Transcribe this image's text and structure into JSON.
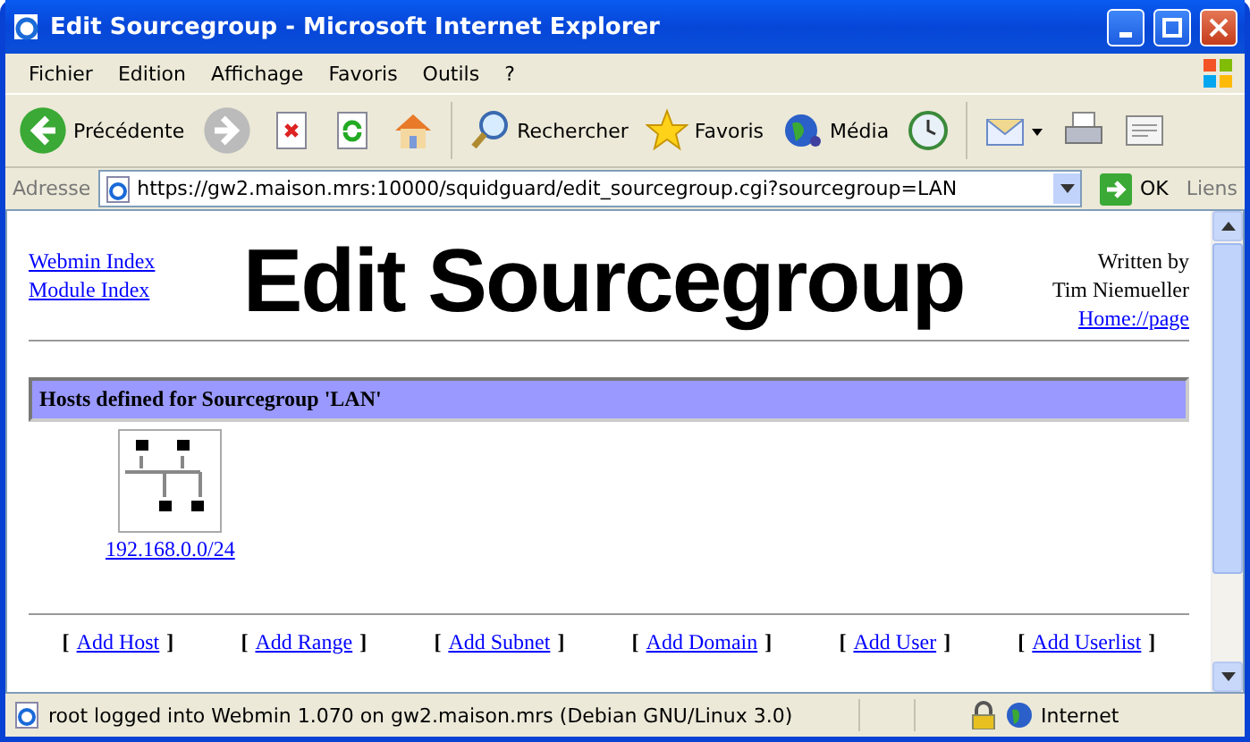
{
  "window": {
    "title": "Edit Sourcegroup - Microsoft Internet Explorer"
  },
  "menu": [
    "Fichier",
    "Edition",
    "Affichage",
    "Favoris",
    "Outils",
    "?"
  ],
  "toolbar": [
    {
      "kind": "back",
      "label": "Précédente"
    },
    {
      "kind": "forward"
    },
    {
      "kind": "stop"
    },
    {
      "kind": "refresh"
    },
    {
      "kind": "home"
    },
    {
      "kind": "search",
      "label": "Rechercher"
    },
    {
      "kind": "favorites",
      "label": "Favoris"
    },
    {
      "kind": "media",
      "label": "Média"
    },
    {
      "kind": "history"
    },
    {
      "kind": "mail"
    },
    {
      "kind": "print"
    },
    {
      "kind": "edit"
    }
  ],
  "address": {
    "label": "Adresse",
    "url": "https://gw2.maison.mrs:10000/squidguard/edit_sourcegroup.cgi?sourcegroup=LAN",
    "go": "OK",
    "links": "Liens"
  },
  "page": {
    "nav_links": [
      "Webmin Index",
      "Module Index"
    ],
    "heading": "Edit Sourcegroup",
    "author_lines": [
      "Written by",
      "Tim Niemueller"
    ],
    "author_link": "Home://page",
    "section_title": "Hosts defined for Sourcegroup 'LAN'",
    "hosts": [
      {
        "label": "192.168.0.0/24"
      }
    ],
    "open_bracket": "[",
    "close_bracket": "]",
    "add_links": [
      "Add Host",
      "Add Range",
      "Add Subnet",
      "Add Domain",
      "Add User",
      "Add Userlist"
    ]
  },
  "status_bar": {
    "text": "root logged into Webmin 1.070 on gw2.maison.mrs (Debian GNU/Linux 3.0)",
    "zone": "Internet"
  }
}
